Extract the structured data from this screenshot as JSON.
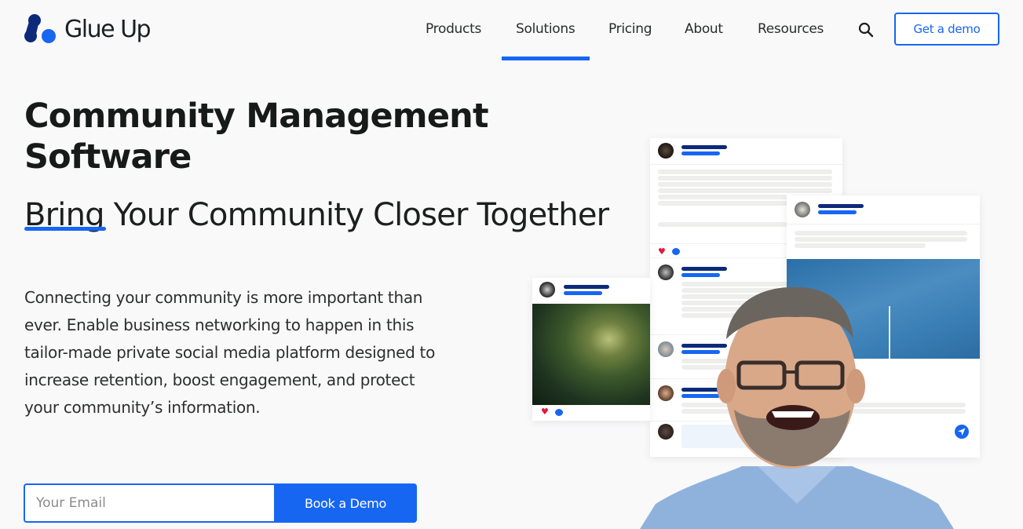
{
  "brand": {
    "name": "Glue Up",
    "logo_icon": "glue-up-logo-icon",
    "accent_color": "#1766f2",
    "dark_color": "#0d2a7a"
  },
  "nav": {
    "items": [
      {
        "label": "Products",
        "active": false
      },
      {
        "label": "Solutions",
        "active": true
      },
      {
        "label": "Pricing",
        "active": false
      },
      {
        "label": "About",
        "active": false
      },
      {
        "label": "Resources",
        "active": false
      }
    ],
    "search_icon": "search-icon",
    "cta_label": "Get a demo"
  },
  "hero": {
    "title": "Community Management Software",
    "subtitle_highlight": "Bring",
    "subtitle_rest": " Your Community Closer Together",
    "description": "Connecting your community is more important than ever. Enable business networking to happen in this tailor-made private social media platform designed to increase retention, boost engagement, and protect your community’s information.",
    "email_placeholder": "Your Email",
    "email_value": "",
    "submit_label": "Book a Demo"
  },
  "illustration": {
    "description": "Social feed mockup cards with avatars, a plant photo, a sky photo and a laughing man in glasses",
    "icons": [
      "heart-icon",
      "comment-icon",
      "send-icon"
    ]
  }
}
